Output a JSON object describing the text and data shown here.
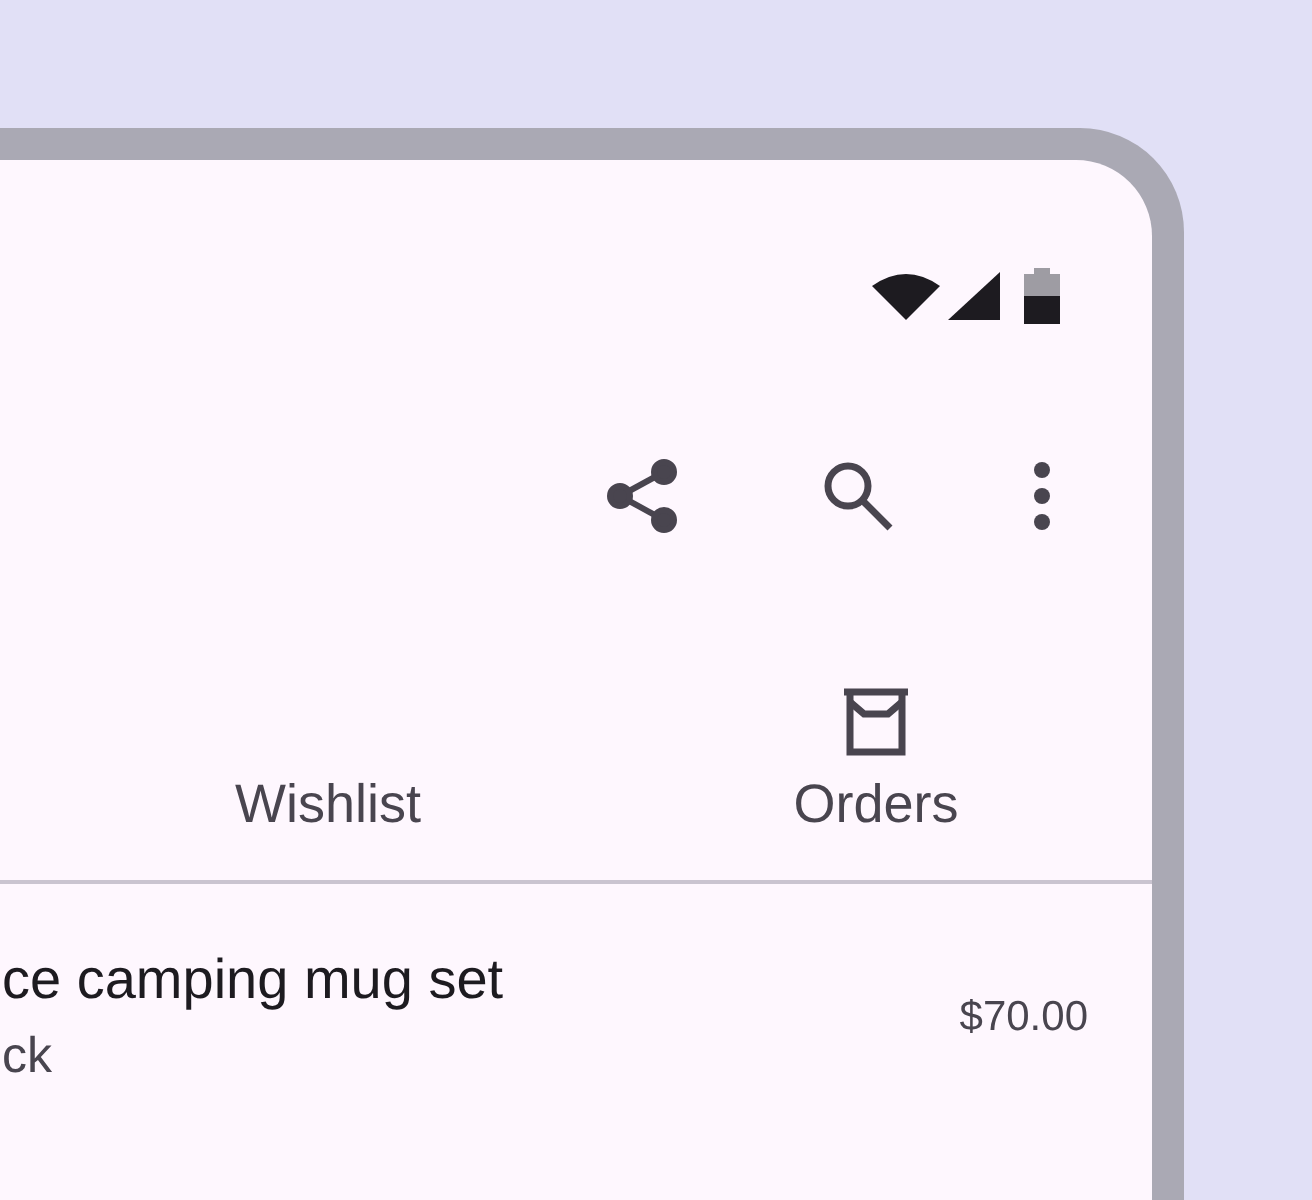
{
  "tabs": [
    {
      "label": "Wishlist",
      "kind": "text"
    },
    {
      "label": "Orders",
      "kind": "icon"
    }
  ],
  "list": [
    {
      "title": "ce camping mug set",
      "subtitle": "ck",
      "price": "$70.00"
    }
  ]
}
